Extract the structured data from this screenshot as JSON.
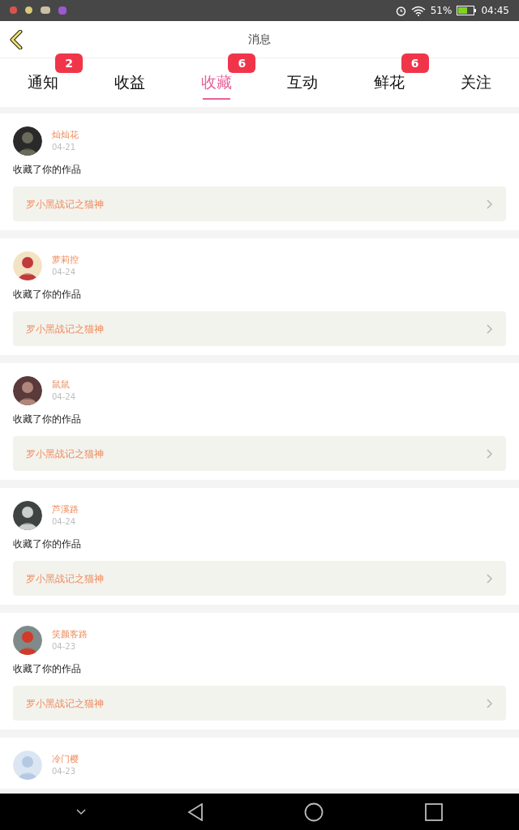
{
  "status_bar": {
    "battery": "51%",
    "time": "04:45"
  },
  "header": {
    "title": "消息"
  },
  "tabs": [
    {
      "label": "通知",
      "selected": false,
      "badge": "2"
    },
    {
      "label": "收益",
      "selected": false
    },
    {
      "label": "收藏",
      "selected": true,
      "badge": "6"
    },
    {
      "label": "互动",
      "selected": false
    },
    {
      "label": "鲜花",
      "selected": false,
      "badge": "6"
    },
    {
      "label": "关注",
      "selected": false
    }
  ],
  "messages": [
    {
      "user": "灿灿花",
      "date": "04-21",
      "text": "收藏了你的作品",
      "work": "罗小黑战记之猫神"
    },
    {
      "user": "萝莉控",
      "date": "04-24",
      "text": "收藏了你的作品",
      "work": "罗小黑战记之猫神"
    },
    {
      "user": "鼠鼠",
      "date": "04-24",
      "text": "收藏了你的作品",
      "work": "罗小黑战记之猫神"
    },
    {
      "user": "芦溪路",
      "date": "04-24",
      "text": "收藏了你的作品",
      "work": "罗小黑战记之猫神"
    },
    {
      "user": "笑颜客路",
      "date": "04-23",
      "text": "收藏了你的作品",
      "work": "罗小黑战记之猫神"
    },
    {
      "user": "冷门樱",
      "date": "04-23"
    }
  ]
}
